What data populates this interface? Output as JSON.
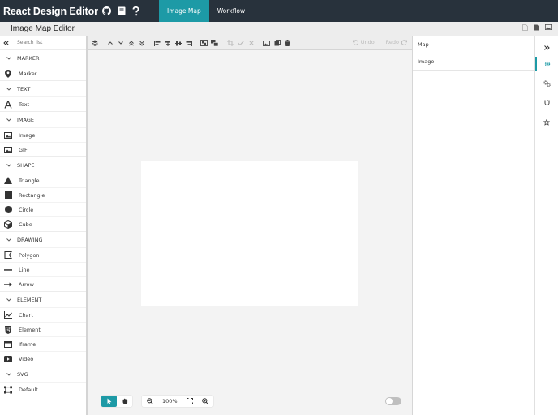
{
  "header": {
    "brand_title": "React Design Editor",
    "brand_icons": [
      "github-icon",
      "book-icon",
      "help-icon"
    ],
    "nav": [
      {
        "label": "Image Map",
        "active": true
      },
      {
        "label": "Workflow",
        "active": false
      }
    ]
  },
  "subbar": {
    "title": "Image Map Editor",
    "actions": [
      "document-icon",
      "file-download-icon",
      "image-icon"
    ]
  },
  "left": {
    "search_placeholder": "Search list",
    "categories": [
      {
        "label": "MARKER",
        "items": [
          {
            "label": "Marker",
            "icon": "map-marker-icon"
          }
        ]
      },
      {
        "label": "TEXT",
        "items": [
          {
            "label": "Text",
            "icon": "font-icon"
          }
        ]
      },
      {
        "label": "IMAGE",
        "items": [
          {
            "label": "Image",
            "icon": "image-icon"
          },
          {
            "label": "GIF",
            "icon": "gif-icon"
          }
        ]
      },
      {
        "label": "SHAPE",
        "items": [
          {
            "label": "Triangle",
            "icon": "triangle-icon"
          },
          {
            "label": "Rectangle",
            "icon": "square-icon"
          },
          {
            "label": "Circle",
            "icon": "circle-icon"
          },
          {
            "label": "Cube",
            "icon": "cube-icon"
          }
        ]
      },
      {
        "label": "DRAWING",
        "items": [
          {
            "label": "Polygon",
            "icon": "polygon-icon"
          },
          {
            "label": "Line",
            "icon": "line-icon"
          },
          {
            "label": "Arrow",
            "icon": "arrow-icon"
          }
        ]
      },
      {
        "label": "ELEMENT",
        "items": [
          {
            "label": "Chart",
            "icon": "chart-icon"
          },
          {
            "label": "Element",
            "icon": "html5-icon"
          },
          {
            "label": "Iframe",
            "icon": "window-icon"
          },
          {
            "label": "Video",
            "icon": "video-icon"
          }
        ]
      },
      {
        "label": "SVG",
        "items": [
          {
            "label": "Default",
            "icon": "svg-nodes-icon"
          }
        ]
      }
    ]
  },
  "toolbar": {
    "undo_label": "Undo",
    "redo_label": "Redo"
  },
  "canvas": {
    "zoom_label": "100%",
    "toggle_on": false,
    "accent": "#1d9aa6"
  },
  "right": {
    "items": [
      "Map",
      "Image"
    ]
  },
  "colors": {
    "header_bg": "#28323c",
    "accent": "#1d9aa6"
  }
}
